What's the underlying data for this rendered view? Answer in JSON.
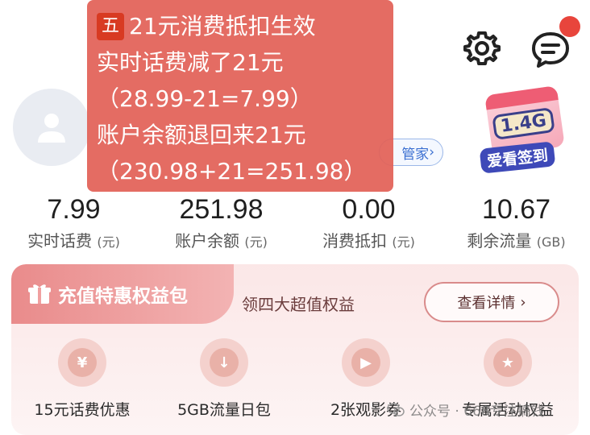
{
  "overlay": {
    "step_badge": "五",
    "lines": [
      "21元消费抵扣生效",
      "实时话费减了21元",
      "（28.99-21=7.99）",
      "账户余额退回来21元",
      "（230.98+21=251.98）"
    ]
  },
  "header": {
    "steward_text": "管家",
    "checkin_badge": "1.4G",
    "checkin_label": "爱看签到"
  },
  "stats": [
    {
      "value": "7.99",
      "label": "实时话费",
      "unit": "(元)"
    },
    {
      "value": "251.98",
      "label": "账户余额",
      "unit": "(元)"
    },
    {
      "value": "0.00",
      "label": "消费抵扣",
      "unit": "(元)"
    },
    {
      "value": "10.67",
      "label": "剩余流量",
      "unit": "(GB)"
    }
  ],
  "card": {
    "title": "充值特惠权益包",
    "subtitle": "领四大超值权益",
    "detail_button": "查看详情"
  },
  "benefits": [
    {
      "icon": "yen-coupon-icon",
      "glyph": "¥",
      "label": "15元话费优惠"
    },
    {
      "icon": "data-download-icon",
      "glyph": "↓",
      "label": "5GB流量日包"
    },
    {
      "icon": "movie-ticket-icon",
      "glyph": "▶",
      "label": "2张观影券"
    },
    {
      "icon": "star-badge-icon",
      "glyph": "★",
      "label": "专属活动权益"
    }
  ],
  "watermark": "公众号 · 668专注搞钱",
  "colors": {
    "overlay": "#e26056",
    "step_badge": "#d83a22",
    "card_bg": "#fbe7e7",
    "card_tab": "#e98b8b",
    "notification_dot": "#e8453c",
    "steward_blue": "#3a6fd1"
  }
}
